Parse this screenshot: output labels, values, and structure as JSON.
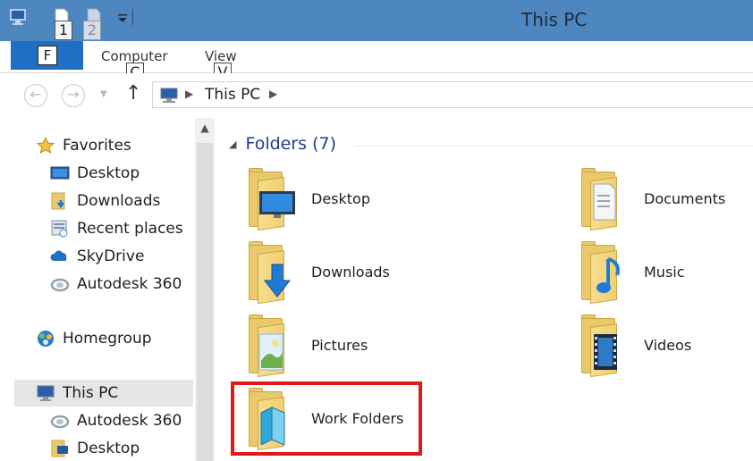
{
  "window": {
    "title": "This PC"
  },
  "quick_access": {
    "keytips": [
      "1",
      "2"
    ]
  },
  "ribbon": {
    "file_keytip": "F",
    "tabs": [
      {
        "label": "Computer",
        "keytip": "C"
      },
      {
        "label": "View",
        "keytip": "V"
      }
    ]
  },
  "address": {
    "breadcrumb": [
      "This PC"
    ]
  },
  "nav_pane": {
    "favorites": {
      "label": "Favorites",
      "items": [
        "Desktop",
        "Downloads",
        "Recent places",
        "SkyDrive",
        "Autodesk 360"
      ]
    },
    "homegroup": {
      "label": "Homegroup"
    },
    "this_pc": {
      "label": "This PC",
      "items": [
        "Autodesk 360",
        "Desktop"
      ]
    }
  },
  "content": {
    "group_header": "Folders (7)",
    "folders": [
      {
        "name": "Desktop",
        "overlay": "desktop-monitor"
      },
      {
        "name": "Documents",
        "overlay": "document-page"
      },
      {
        "name": "Downloads",
        "overlay": "download-arrow"
      },
      {
        "name": "Music",
        "overlay": "music-note"
      },
      {
        "name": "Pictures",
        "overlay": "picture-landscape"
      },
      {
        "name": "Videos",
        "overlay": "film-strip"
      },
      {
        "name": "Work Folders",
        "overlay": "work-folders-book"
      }
    ]
  },
  "colors": {
    "titlebar": "#4e86c0",
    "file_tab": "#1f6fc4",
    "group_header": "#1e3d8c",
    "highlight_box": "#e01a1a"
  }
}
